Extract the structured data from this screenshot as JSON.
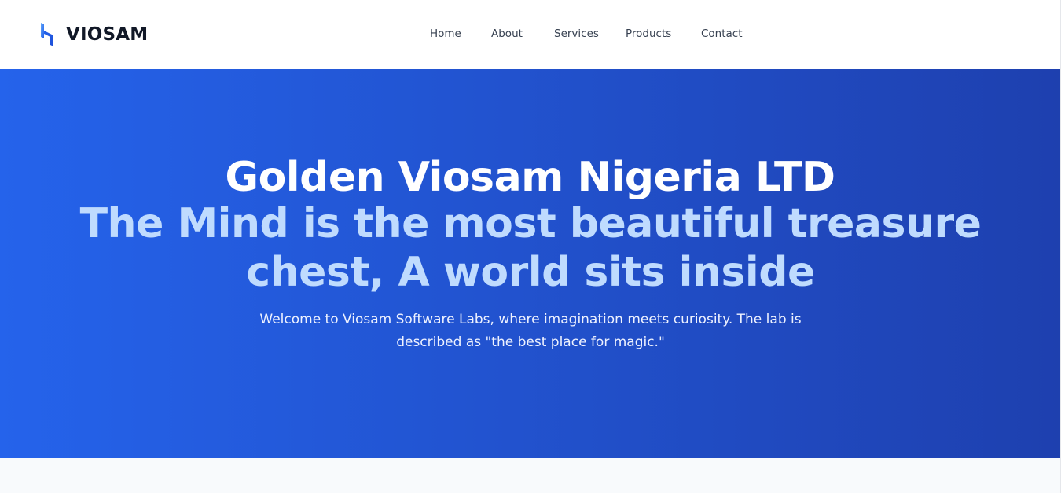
{
  "header": {
    "brand_name": "VIOSAM",
    "logo_icon": "viosam-logo-icon",
    "nav": [
      {
        "label": "Home"
      },
      {
        "label": "About"
      },
      {
        "label": "Services"
      },
      {
        "label": "Products"
      },
      {
        "label": "Contact"
      }
    ]
  },
  "hero": {
    "title": "Golden Viosam Nigeria LTD",
    "tagline": "The Mind is the most beautiful treasure chest, A world sits inside",
    "description": "Welcome to Viosam Software Labs, where imagination meets curiosity. The lab is described as \"the best place for magic.\""
  },
  "colors": {
    "hero_gradient_start": "#2563eb",
    "hero_gradient_end": "#1e40af",
    "title_color": "#ffffff",
    "tagline_color": "#bfdbfe",
    "page_background": "#f8fafc"
  }
}
